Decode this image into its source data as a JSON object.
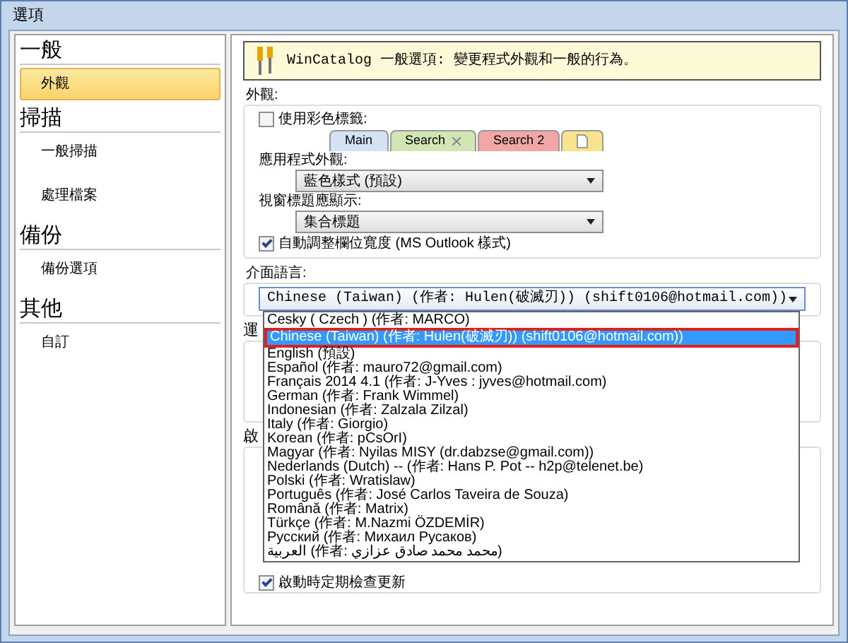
{
  "window": {
    "title": "選項"
  },
  "sidebar": {
    "sections": [
      {
        "title": "一般",
        "items": [
          {
            "label": "外觀",
            "selected": true
          }
        ]
      },
      {
        "title": "掃描",
        "items": [
          {
            "label": "一般掃描",
            "selected": false
          },
          {
            "label": "處理檔案",
            "selected": false
          }
        ]
      },
      {
        "title": "備份",
        "items": [
          {
            "label": "備份選項",
            "selected": false
          }
        ]
      },
      {
        "title": "其他",
        "items": [
          {
            "label": "自訂",
            "selected": false
          }
        ]
      }
    ]
  },
  "header": {
    "text": "WinCatalog 一般選項: 變更程式外觀和一般的行為。"
  },
  "appearance": {
    "title": "外觀:",
    "color_tabs": {
      "label": "使用彩色標籤:",
      "checked": false
    },
    "tab_preview": [
      {
        "kind": "tab",
        "label": "Main",
        "color": "#d3e2f4",
        "closable": false
      },
      {
        "kind": "tab",
        "label": "Search",
        "color": "#d2e5b4",
        "closable": true
      },
      {
        "kind": "tab",
        "label": "Search 2",
        "color": "#f2a7a7",
        "closable": false
      },
      {
        "kind": "new",
        "color": "#f7e48c"
      }
    ],
    "app_style": {
      "label": "應用程式外觀:",
      "value": "藍色樣式 (預設)"
    },
    "title_display": {
      "label": "視窗標題應顯示:",
      "value": "集合標題"
    },
    "auto_width": {
      "label": "自動調整欄位寬度 (MS Outlook 樣式)",
      "checked": true
    }
  },
  "language": {
    "title": "介面語言:",
    "value": "Chinese (Taiwan) (作者: Hulen(破滅刃)) (shift0106@hotmail.com))",
    "expanded": true,
    "options": [
      {
        "label": "Cesky ( Czech ) (作者: MARCO)",
        "selected": false,
        "highlighted": false
      },
      {
        "label": "Chinese (Taiwan) (作者: Hulen(破滅刃)) (shift0106@hotmail.com))",
        "selected": true,
        "highlighted": true
      },
      {
        "label": "English (預設)",
        "selected": false,
        "highlighted": false
      },
      {
        "label": "Español (作者: mauro72@gmail.com)",
        "selected": false,
        "highlighted": false
      },
      {
        "label": "Français 2014 4.1 (作者: J-Yves :  jyves@hotmail.com)",
        "selected": false,
        "highlighted": false
      },
      {
        "label": "German (作者: Frank Wimmel)",
        "selected": false,
        "highlighted": false
      },
      {
        "label": "Indonesian (作者: Zalzala Zilzal)",
        "selected": false,
        "highlighted": false
      },
      {
        "label": "Italy (作者: Giorgio)",
        "selected": false,
        "highlighted": false
      },
      {
        "label": "Korean (作者: pCsOrI)",
        "selected": false,
        "highlighted": false
      },
      {
        "label": "Magyar (作者: Nyilas MISY (dr.dabzse@gmail.com))",
        "selected": false,
        "highlighted": false
      },
      {
        "label": "Nederlands (Dutch) -- (作者: Hans P. Pot -- h2p@telenet.be)",
        "selected": false,
        "highlighted": false
      },
      {
        "label": "Polski (作者: Wratislaw)",
        "selected": false,
        "highlighted": false
      },
      {
        "label": "Português (作者: José Carlos Taveira de Souza)",
        "selected": false,
        "highlighted": false
      },
      {
        "label": "Română (作者: Matrix)",
        "selected": false,
        "highlighted": false
      },
      {
        "label": "Türkçe (作者: M.Nazmi ÖZDEMİR)",
        "selected": false,
        "highlighted": false
      },
      {
        "label": "Русский (作者: Михаил Русаков)",
        "selected": false,
        "highlighted": false
      },
      {
        "label": "العربية (作者: محمد محمد صادق عزازي)",
        "selected": false,
        "highlighted": false
      }
    ]
  },
  "covered_groups": [
    {
      "title": "運"
    },
    {
      "title": "啟"
    }
  ],
  "update_check": {
    "label": "啟動時定期檢查更新",
    "checked": true
  }
}
